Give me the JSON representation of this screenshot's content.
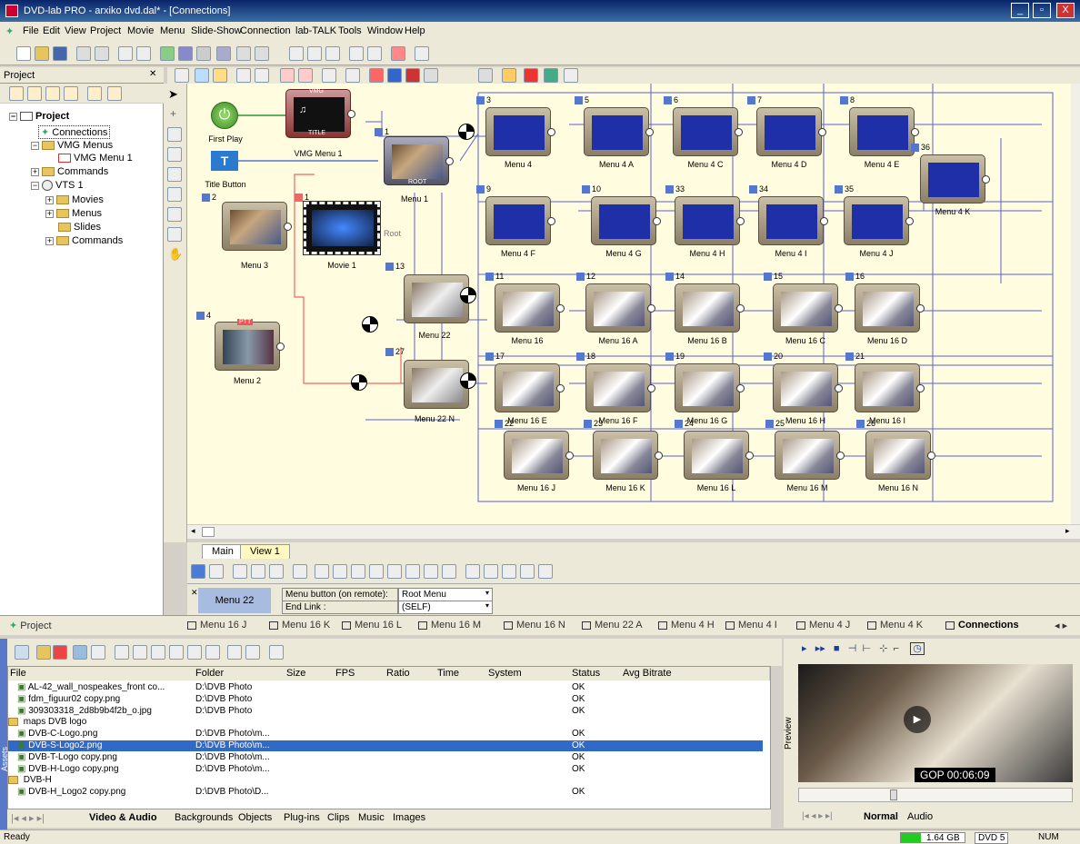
{
  "window": {
    "title": "DVD-lab PRO - arxiko dvd.dal* - [Connections]",
    "min": "_",
    "max": "▫",
    "close": "X"
  },
  "menu": [
    "File",
    "Edit",
    "View",
    "Project",
    "Movie",
    "Menu",
    "Slide-Show",
    "Connection",
    "lab-TALK",
    "Tools",
    "Window",
    "Help"
  ],
  "project": {
    "header": "Project",
    "tree": [
      "Project",
      "Connections",
      "VMG Menus",
      "VMG Menu 1",
      "Commands",
      "VTS 1",
      "Movies",
      "Menus",
      "Slides",
      "Commands"
    ]
  },
  "canvas": {
    "first_play": "First Play",
    "vmg_menu": "VMG Menu 1",
    "vmg_tag": "VMG",
    "title_tag": "TITLE",
    "title_button": "Title Button",
    "root_tag": "ROOT",
    "root_menu": "Menu 1",
    "root_label": "Root",
    "pttt_tag": "PTT",
    "nodes": [
      {
        "num": "3",
        "label": "Menu 4"
      },
      {
        "num": "5",
        "label": "Menu 4 A"
      },
      {
        "num": "6",
        "label": "Menu 4 C"
      },
      {
        "num": "7",
        "label": "Menu 4 D"
      },
      {
        "num": "8",
        "label": "Menu 4 E"
      },
      {
        "num": "9",
        "label": "Menu 4 F"
      },
      {
        "num": "10",
        "label": "Menu 4 G"
      },
      {
        "num": "33",
        "label": "Menu 4 H"
      },
      {
        "num": "34",
        "label": "Menu 4 I"
      },
      {
        "num": "35",
        "label": "Menu 4 J"
      },
      {
        "num": "36",
        "label": "Menu 4 K"
      },
      {
        "num": "11",
        "label": "Menu 16"
      },
      {
        "num": "12",
        "label": "Menu 16 A"
      },
      {
        "num": "14",
        "label": "Menu 16 B"
      },
      {
        "num": "15",
        "label": "Menu 16 C"
      },
      {
        "num": "16",
        "label": "Menu 16 D"
      },
      {
        "num": "17",
        "label": "Menu 16 E"
      },
      {
        "num": "18",
        "label": "Menu 16 F"
      },
      {
        "num": "19",
        "label": "Menu 16 G"
      },
      {
        "num": "20",
        "label": "Menu 16 H"
      },
      {
        "num": "21",
        "label": "Menu 16 I"
      },
      {
        "num": "22",
        "label": "Menu 16 J"
      },
      {
        "num": "23",
        "label": "Menu 16 K"
      },
      {
        "num": "24",
        "label": "Menu 16 L"
      },
      {
        "num": "25",
        "label": "Menu 16 M"
      },
      {
        "num": "26",
        "label": "Menu 16 N"
      },
      {
        "num": "2",
        "label": "Menu 3"
      },
      {
        "num": "1",
        "label": "Movie 1"
      },
      {
        "num": "4",
        "label": "Menu 2"
      },
      {
        "num": "13",
        "label": "Menu 22"
      },
      {
        "num": "27",
        "label": "Menu 22 N"
      }
    ]
  },
  "tabs": {
    "main": "Main",
    "view1": "View 1"
  },
  "props": {
    "selected": "Menu 22",
    "row1_label": "Menu button (on remote):",
    "row1_value": "Root Menu",
    "row2_label": "End Link :",
    "row2_value": "(SELF)"
  },
  "doc_tabs": [
    "Menu 16 J",
    "Menu 16 K",
    "Menu 16 L",
    "Menu 16 M",
    "Menu 16 N",
    "Menu 22 A",
    "Menu 4 H",
    "Menu 4 I",
    "Menu 4 J",
    "Menu 4 K",
    "Connections"
  ],
  "project_tab": "Project",
  "files": {
    "columns": [
      "File",
      "Folder",
      "Size",
      "FPS",
      "Ratio",
      "Time",
      "System",
      "Status",
      "Avg Bitrate"
    ],
    "rows": [
      {
        "file": "AL-42_wall_nospeakes_front co...",
        "folder": "D:\\DVB Photo",
        "status": "OK",
        "type": "img",
        "sel": false
      },
      {
        "file": "fdm_figuur02 copy.png",
        "folder": "D:\\DVB Photo",
        "status": "OK",
        "type": "img",
        "sel": false
      },
      {
        "file": "309303318_2d8b9b4f2b_o.jpg",
        "folder": "D:\\DVB Photo",
        "status": "OK",
        "type": "img",
        "sel": false
      },
      {
        "file": "maps DVB logo",
        "folder": "",
        "status": "",
        "type": "folder",
        "sel": false
      },
      {
        "file": "DVB-C-Logo.png",
        "folder": "D:\\DVB Photo\\m...",
        "status": "OK",
        "type": "img",
        "sel": false
      },
      {
        "file": "DVB-S-Logo2.png",
        "folder": "D:\\DVB Photo\\m...",
        "status": "OK",
        "type": "img",
        "sel": true
      },
      {
        "file": "DVB-T-Logo copy.png",
        "folder": "D:\\DVB Photo\\m...",
        "status": "OK",
        "type": "img",
        "sel": false
      },
      {
        "file": "DVB-H-Logo copy.png",
        "folder": "D:\\DVB Photo\\m...",
        "status": "OK",
        "type": "img",
        "sel": false
      },
      {
        "file": "DVB-H",
        "folder": "",
        "status": "",
        "type": "folder",
        "sel": false
      },
      {
        "file": "DVB-H_Logo2 copy.png",
        "folder": "D:\\DVB Photo\\D...",
        "status": "OK",
        "type": "img",
        "sel": false
      }
    ]
  },
  "asset_tabs": [
    "Video & Audio",
    "Backgrounds",
    "Objects",
    "Plug-ins",
    "Clips",
    "Music",
    "Images"
  ],
  "assets_side": "Assets",
  "preview": {
    "side": "Preview",
    "gop": "GOP 00:06:09",
    "tab_normal": "Normal",
    "tab_audio": "Audio"
  },
  "status": {
    "ready": "Ready",
    "disk": "1.64 GB",
    "disc": "DVD 5",
    "num": "NUM"
  },
  "colors": {
    "accent": "#3169c6",
    "canvas": "#fffce0",
    "link": "#5a62d8"
  }
}
